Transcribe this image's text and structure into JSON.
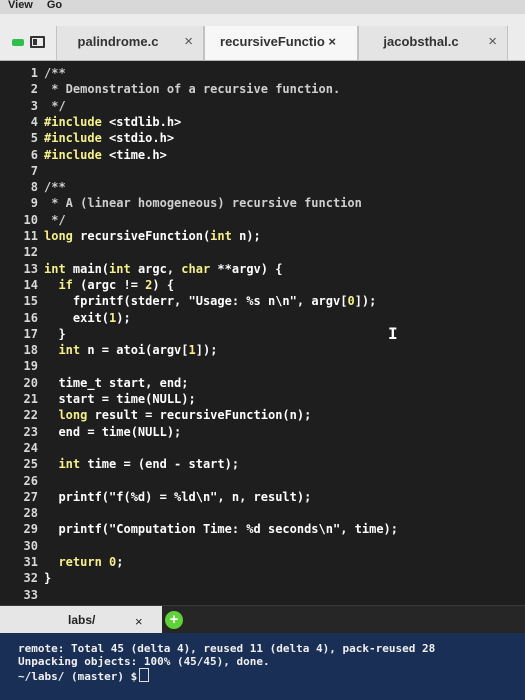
{
  "menubar": {
    "items": [
      "View",
      "Go"
    ]
  },
  "tabs": [
    {
      "label": "palindrome.c",
      "close": "×"
    },
    {
      "label": "recursiveFunctio ×",
      "close": ""
    },
    {
      "label": "jacobsthal.c",
      "close": "×"
    }
  ],
  "editor": {
    "lines": [
      {
        "n": "1",
        "t": [
          {
            "s": "/**",
            "c": "#c9c9c9"
          }
        ]
      },
      {
        "n": "2",
        "t": [
          {
            "s": " * Demonstration of a recursive function.",
            "c": "#cfcfcf"
          }
        ]
      },
      {
        "n": "3",
        "t": [
          {
            "s": " */",
            "c": "#cfcfcf"
          }
        ]
      },
      {
        "n": "4",
        "t": [
          {
            "s": "#include ",
            "c": "#f6f08a"
          },
          {
            "s": "<stdlib.h>",
            "c": "#ffffff"
          }
        ]
      },
      {
        "n": "5",
        "t": [
          {
            "s": "#include ",
            "c": "#f6f08a"
          },
          {
            "s": "<stdio.h>",
            "c": "#ffffff"
          }
        ]
      },
      {
        "n": "6",
        "t": [
          {
            "s": "#include ",
            "c": "#f6f08a"
          },
          {
            "s": "<time.h>",
            "c": "#ffffff"
          }
        ]
      },
      {
        "n": "7",
        "t": []
      },
      {
        "n": "8",
        "t": [
          {
            "s": "/**",
            "c": "#cfcfcf"
          }
        ]
      },
      {
        "n": "9",
        "t": [
          {
            "s": " * A (linear homogeneous) recursive function",
            "c": "#cfcfcf"
          }
        ]
      },
      {
        "n": "10",
        "t": [
          {
            "s": " */",
            "c": "#cfcfcf"
          }
        ]
      },
      {
        "n": "11",
        "t": [
          {
            "s": "long ",
            "c": "#f6f08a"
          },
          {
            "s": "recursiveFunction(",
            "c": "#ffffff"
          },
          {
            "s": "int ",
            "c": "#f6f08a"
          },
          {
            "s": "n);",
            "c": "#ffffff"
          }
        ]
      },
      {
        "n": "12",
        "t": []
      },
      {
        "n": "13",
        "t": [
          {
            "s": "int ",
            "c": "#f6f08a"
          },
          {
            "s": "main(",
            "c": "#ffffff"
          },
          {
            "s": "int ",
            "c": "#f6f08a"
          },
          {
            "s": "argc, ",
            "c": "#ffffff"
          },
          {
            "s": "char ",
            "c": "#f6f08a"
          },
          {
            "s": "**argv) {",
            "c": "#ffffff"
          }
        ]
      },
      {
        "n": "14",
        "t": [
          {
            "s": "  if ",
            "c": "#f6f08a"
          },
          {
            "s": "(argc != ",
            "c": "#ffffff"
          },
          {
            "s": "2",
            "c": "#f6f08a"
          },
          {
            "s": ") {",
            "c": "#ffffff"
          }
        ]
      },
      {
        "n": "15",
        "t": [
          {
            "s": "    fprintf(stderr, ",
            "c": "#ffffff"
          },
          {
            "s": "\"Usage: %s n\\n\"",
            "c": "#ffffff"
          },
          {
            "s": ", argv[",
            "c": "#ffffff"
          },
          {
            "s": "0",
            "c": "#f6f08a"
          },
          {
            "s": "]);",
            "c": "#ffffff"
          }
        ]
      },
      {
        "n": "16",
        "t": [
          {
            "s": "    exit(",
            "c": "#ffffff"
          },
          {
            "s": "1",
            "c": "#f6f08a"
          },
          {
            "s": ");",
            "c": "#ffffff"
          }
        ]
      },
      {
        "n": "17",
        "t": [
          {
            "s": "  }",
            "c": "#ffffff"
          }
        ]
      },
      {
        "n": "18",
        "t": [
          {
            "s": "  int ",
            "c": "#f6f08a"
          },
          {
            "s": "n = atoi(argv[",
            "c": "#ffffff"
          },
          {
            "s": "1",
            "c": "#f6f08a"
          },
          {
            "s": "]);",
            "c": "#ffffff"
          }
        ]
      },
      {
        "n": "19",
        "t": []
      },
      {
        "n": "20",
        "t": [
          {
            "s": "  time_t start, end;",
            "c": "#ffffff"
          }
        ]
      },
      {
        "n": "21",
        "t": [
          {
            "s": "  start = time(NULL);",
            "c": "#ffffff"
          }
        ]
      },
      {
        "n": "22",
        "t": [
          {
            "s": "  long ",
            "c": "#f6f08a"
          },
          {
            "s": "result = recursiveFunction(n);",
            "c": "#ffffff"
          }
        ]
      },
      {
        "n": "23",
        "t": [
          {
            "s": "  end = time(NULL);",
            "c": "#ffffff"
          }
        ]
      },
      {
        "n": "24",
        "t": []
      },
      {
        "n": "25",
        "t": [
          {
            "s": "  int ",
            "c": "#f6f08a"
          },
          {
            "s": "time = (end - start);",
            "c": "#ffffff"
          }
        ]
      },
      {
        "n": "26",
        "t": []
      },
      {
        "n": "27",
        "t": [
          {
            "s": "  printf(\"f(%d) = %ld\\n\", n, result);",
            "c": "#ffffff"
          }
        ]
      },
      {
        "n": "28",
        "t": []
      },
      {
        "n": "29",
        "t": [
          {
            "s": "  printf(\"Computation Time: %d seconds\\n\", time);",
            "c": "#ffffff"
          }
        ]
      },
      {
        "n": "30",
        "t": []
      },
      {
        "n": "31",
        "t": [
          {
            "s": "  return ",
            "c": "#f6f08a"
          },
          {
            "s": "0",
            "c": "#f6f08a"
          },
          {
            "s": ";",
            "c": "#ffffff"
          }
        ]
      },
      {
        "n": "32",
        "t": [
          {
            "s": "}",
            "c": "#ffffff"
          }
        ]
      },
      {
        "n": "33",
        "t": []
      }
    ]
  },
  "terminal": {
    "tab_label": "labs/",
    "tab_close": "×",
    "add_label": "+",
    "lines": [
      "remote: Total 45 (delta 4), reused 11 (delta 4), pack-reused 28",
      "Unpacking objects: 100% (45/45), done.",
      "~/labs/ (master) $"
    ]
  },
  "colors": {
    "keyword": "#f6f08a",
    "text": "#ffffff",
    "terminal_bg": "#1a2f55",
    "add_button": "#5fd23a"
  },
  "icons": [
    "file-icon",
    "close-icon",
    "plus-icon",
    "ibeam-cursor-icon"
  ]
}
